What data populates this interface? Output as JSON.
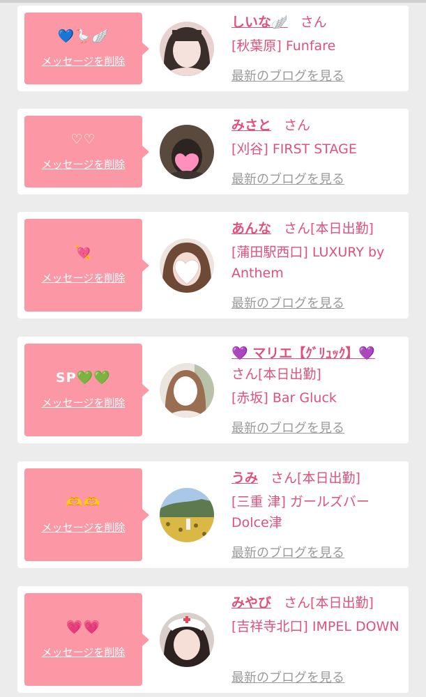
{
  "delete_label": "メッセージを削除",
  "blog_label": "最新のブログを見る",
  "san_label": "さん",
  "accent_color": "#fc98a6",
  "text_color": "#e0507a",
  "entries": [
    {
      "message": "💙🪿🪽",
      "name": "しいな🪽",
      "status": "",
      "shop": "[秋葉原] Funfare"
    },
    {
      "message": "♡♡",
      "name": "みさと",
      "status": "",
      "shop": "[刈谷] FIRST STAGE"
    },
    {
      "message": "💘",
      "name": "あんな",
      "status": "[本日出勤]",
      "shop": "[蒲田駅西口] LUXURY by Anthem"
    },
    {
      "message": "SP💚💚",
      "name": "💜 マリエ【ｸﾞﾘｭｯｸ】💜",
      "status": "[本日出勤]",
      "shop": "[赤坂] Bar Gluck"
    },
    {
      "message": "🫶🫶",
      "name": "うみ",
      "status": "[本日出勤]",
      "shop": "[三重 津] ガールズバーDolce津"
    },
    {
      "message": "💗💗",
      "name": "みやび",
      "status": "[本日出勤]",
      "shop": "[吉祥寺北口] IMPEL DOWN"
    }
  ]
}
